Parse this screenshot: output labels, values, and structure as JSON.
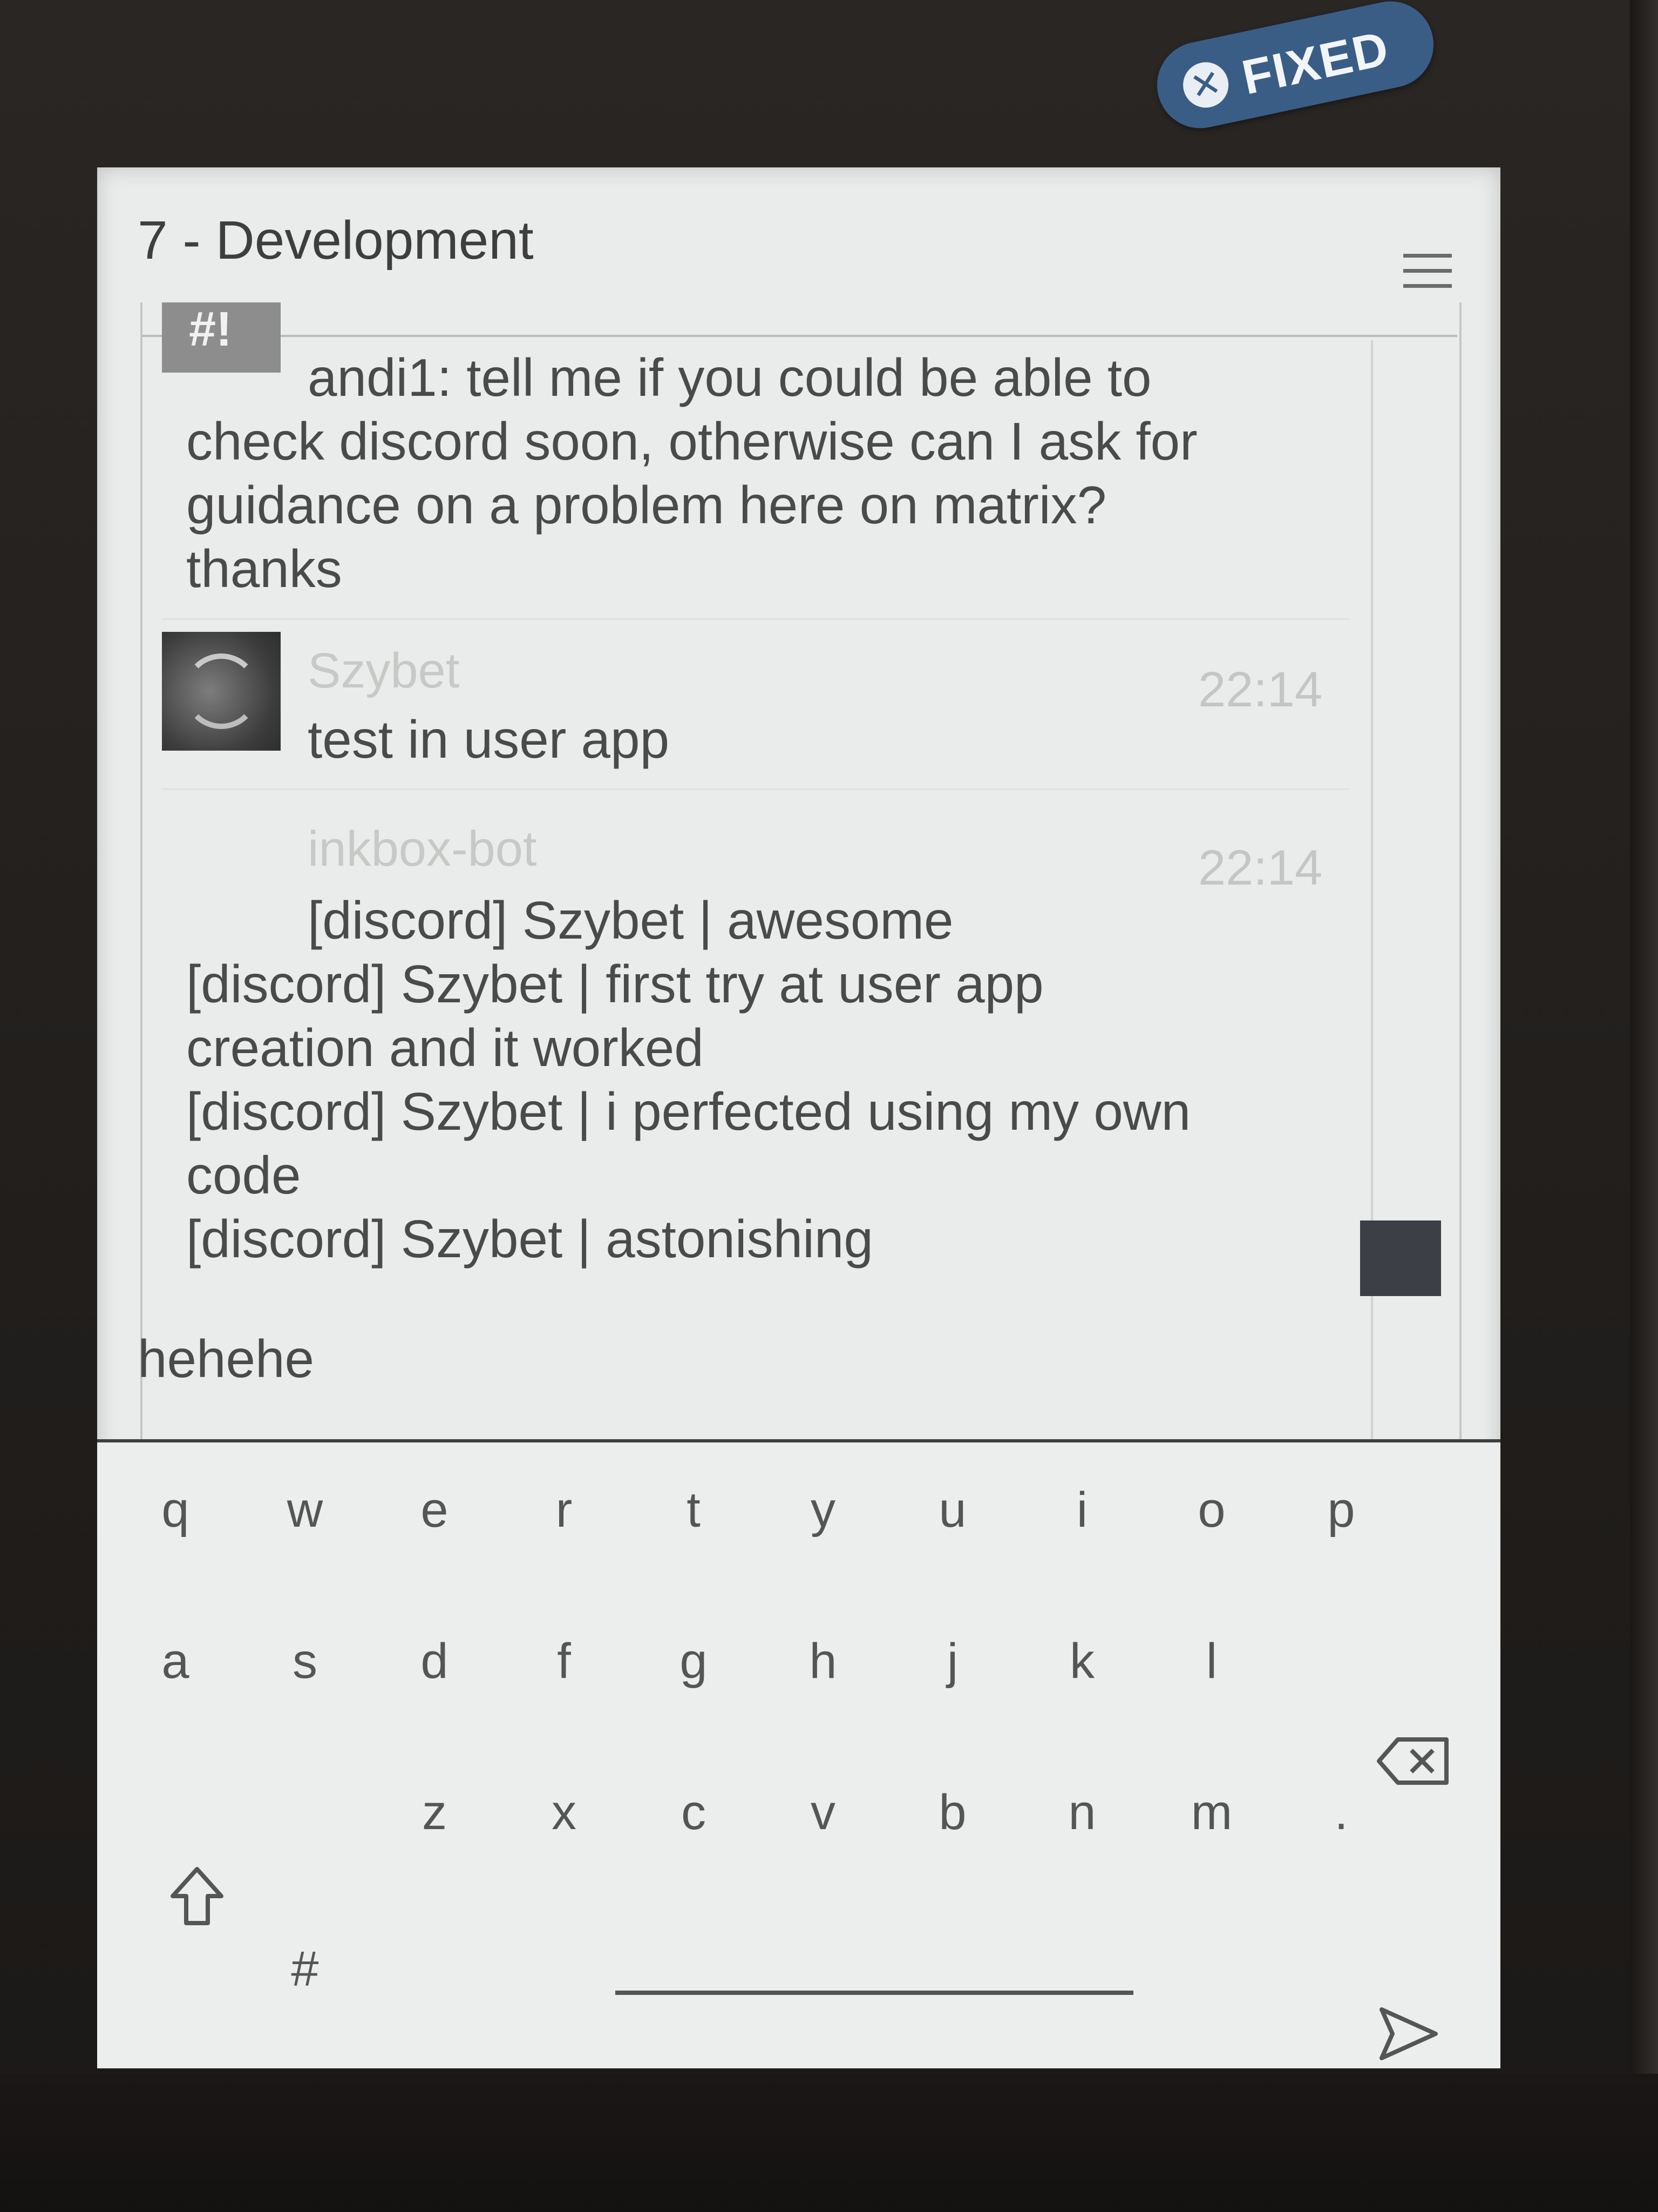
{
  "badge": {
    "label": "FIXED",
    "icon": "close-icon"
  },
  "header": {
    "title": "7 - Development",
    "menu_icon": "hamburger-menu-icon"
  },
  "chat": {
    "room_avatar_text": "#!",
    "messages": [
      {
        "lines": [
          "andi1: tell me if you could be able to",
          "check discord soon, otherwise can I ask for",
          "guidance on a problem here on matrix?",
          "thanks"
        ]
      },
      {
        "sender": "Szybet",
        "time": "22:14",
        "lines": [
          "test in user app"
        ]
      },
      {
        "sender": "inkbox-bot",
        "time": "22:14",
        "lines": [
          "[discord] Szybet | awesome",
          "[discord] Szybet | first try at user app",
          "creation and it worked",
          "[discord] Szybet | i perfected using my own",
          "code",
          "[discord] Szybet | astonishing"
        ]
      }
    ]
  },
  "compose": {
    "text": "hehehe"
  },
  "keyboard": {
    "row1": [
      "q",
      "w",
      "e",
      "r",
      "t",
      "y",
      "u",
      "i",
      "o",
      "p"
    ],
    "row2": [
      "a",
      "s",
      "d",
      "f",
      "g",
      "h",
      "j",
      "k",
      "l"
    ],
    "row3": [
      "z",
      "x",
      "c",
      "v",
      "b",
      "n",
      "m",
      "."
    ],
    "symbols_key": "#",
    "shift_icon": "shift-arrow-icon",
    "backspace_icon": "backspace-icon",
    "send_icon": "send-icon"
  }
}
